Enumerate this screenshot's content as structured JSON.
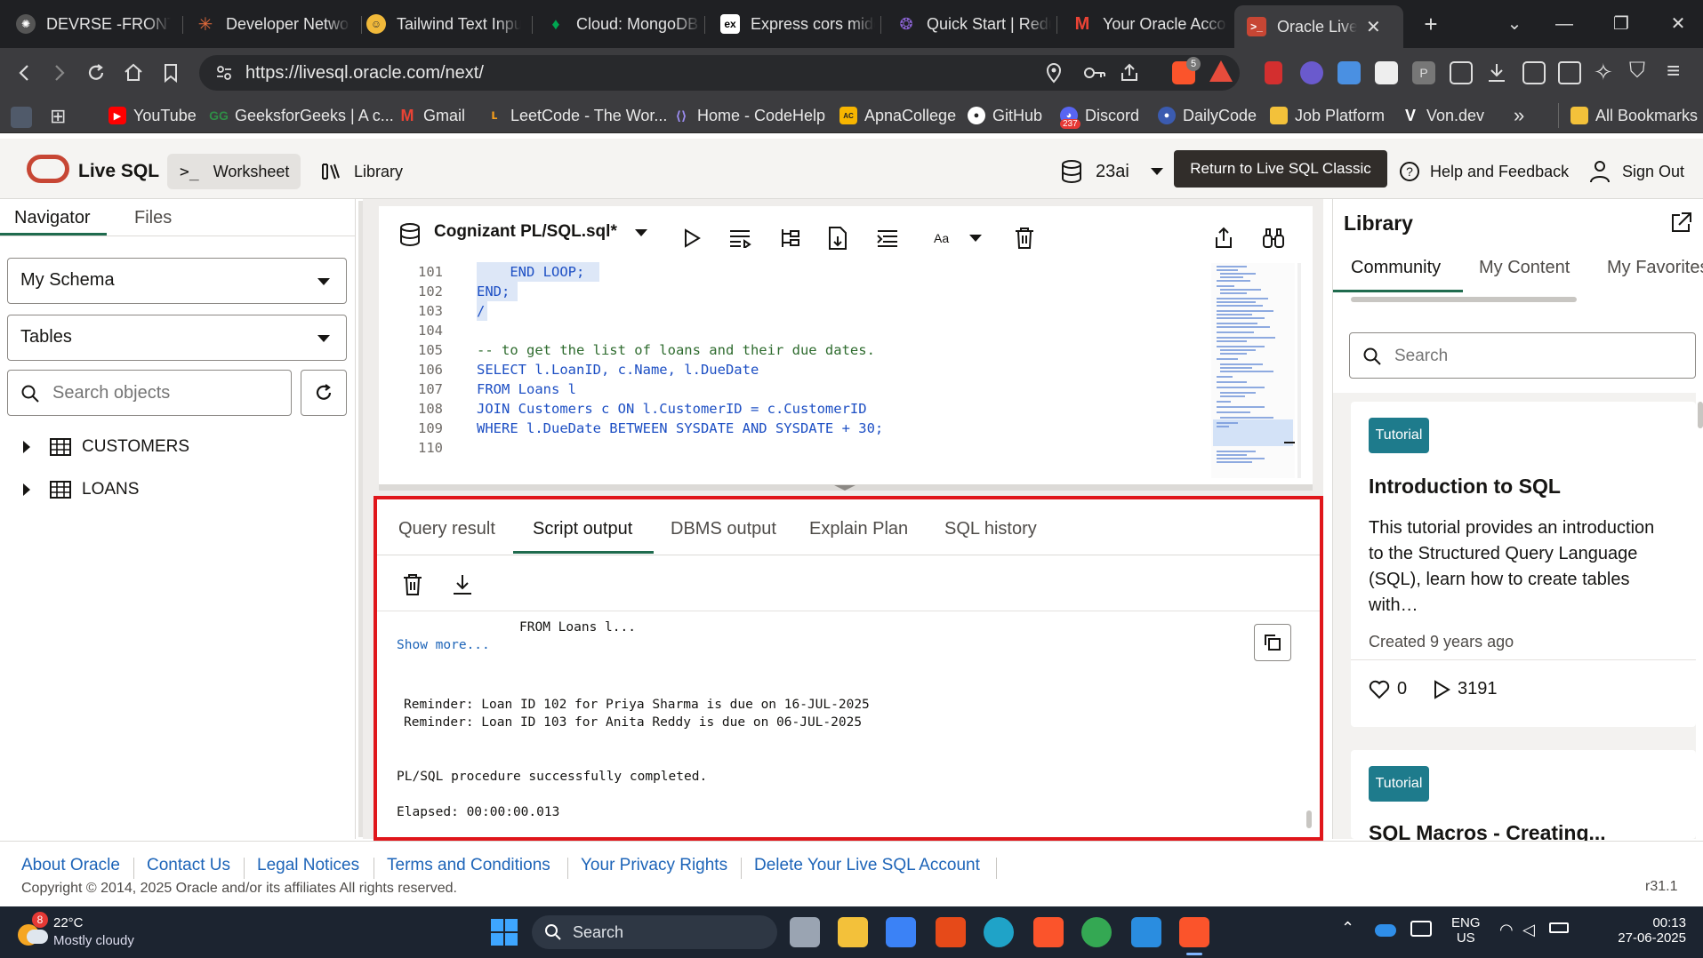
{
  "browser": {
    "tabs": [
      {
        "title": "DEVRSE -FRONTE",
        "color": "#6b6b6b"
      },
      {
        "title": "Developer Netwo",
        "color": "#e06a3b"
      },
      {
        "title": "Tailwind Text Inpu",
        "color": "#f1b93a"
      },
      {
        "title": "Cloud: MongoDB",
        "color": "#00a651"
      },
      {
        "title": "Express cors midd",
        "color": "#ffffff"
      },
      {
        "title": "Quick Start | Redu",
        "color": "#764abc"
      },
      {
        "title": "Your Oracle Accou",
        "color": "#ea4335"
      },
      {
        "title": "Oracle Live S",
        "color": "#c74634"
      }
    ],
    "express_fav": "ex",
    "url": "https://livesql.oracle.com/next/",
    "bookmarks": [
      {
        "label": "YouTube",
        "color": "#ff0000"
      },
      {
        "label": "GeeksforGeeks | A c...",
        "color": "#2f8d46"
      },
      {
        "label": "Gmail",
        "color": "#ea4335"
      },
      {
        "label": "LeetCode - The Wor...",
        "color": "#f89f1b"
      },
      {
        "label": "Home - CodeHelp",
        "color": "#6e5bd8"
      },
      {
        "label": "ApnaCollege",
        "color": "#f7b500"
      },
      {
        "label": "GitHub",
        "color": "#ffffff"
      },
      {
        "label": "Discord",
        "color": "#5865f2"
      },
      {
        "label": "DailyCode",
        "color": "#3b82f6"
      },
      {
        "label": "Job Platform",
        "color": "#f3c13a"
      },
      {
        "label": "Von.dev",
        "color": "#ffffff"
      }
    ],
    "more_bookmarks": "»",
    "all_bookmarks": "All Bookmarks",
    "discord_badge": "237",
    "brave_badge": "5"
  },
  "app": {
    "brand": "Live SQL",
    "worksheet": "Worksheet",
    "library": "Library",
    "db_version": "23ai",
    "classic_button": "Return to Live SQL Classic",
    "help": "Help and Feedback",
    "signout": "Sign Out"
  },
  "navigator": {
    "tabs": [
      "Navigator",
      "Files"
    ],
    "schema": "My Schema",
    "object_type": "Tables",
    "search_placeholder": "Search objects",
    "tables": [
      "CUSTOMERS",
      "LOANS"
    ]
  },
  "editor": {
    "file_name": "Cognizant PL/SQL.sql*",
    "font_label": "Aa",
    "lines": [
      {
        "n": "101",
        "text": "    END LOOP;"
      },
      {
        "n": "102",
        "text": "END;"
      },
      {
        "n": "103",
        "text": "/"
      },
      {
        "n": "104",
        "text": ""
      },
      {
        "n": "105",
        "text": "-- to get the list of loans and their due dates."
      },
      {
        "n": "106",
        "text": "SELECT l.LoanID, c.Name, l.DueDate"
      },
      {
        "n": "107",
        "text": "FROM Loans l"
      },
      {
        "n": "108",
        "text": "JOIN Customers c ON l.CustomerID = c.CustomerID"
      },
      {
        "n": "109",
        "text": "WHERE l.DueDate BETWEEN SYSDATE AND SYSDATE + 30;"
      },
      {
        "n": "110",
        "text": ""
      }
    ]
  },
  "results": {
    "tabs": [
      "Query result",
      "Script output",
      "DBMS output",
      "Explain Plan",
      "SQL history"
    ],
    "output": {
      "from_line": "FROM Loans l...",
      "show_more": "Show more...",
      "reminder1": "Reminder: Loan ID 102 for Priya Sharma is due on 16-JUL-2025",
      "reminder2": "Reminder: Loan ID 103 for Anita Reddy is due on 06-JUL-2025",
      "completed": "PL/SQL procedure successfully completed.",
      "elapsed": "Elapsed: 00:00:00.013"
    }
  },
  "library": {
    "title": "Library",
    "tabs": [
      "Community",
      "My Content",
      "My Favorites"
    ],
    "search_placeholder": "Search",
    "cards": [
      {
        "badge": "Tutorial",
        "title": "Introduction to SQL",
        "desc": "This tutorial provides an introduction to the Structured Query Language (SQL), learn how to create tables with…",
        "created": "Created 9 years ago",
        "likes": "0",
        "plays": "3191"
      },
      {
        "badge": "Tutorial",
        "title": "SQL Macros - Creating..."
      }
    ]
  },
  "footer": {
    "links": [
      "About Oracle",
      "Contact Us",
      "Legal Notices",
      "Terms and Conditions",
      "Your Privacy Rights",
      "Delete Your Live SQL Account"
    ],
    "copyright": "Copyright © 2014, 2025 Oracle and/or its affiliates All rights reserved.",
    "version": "r31.1"
  },
  "taskbar": {
    "weather_badge": "8",
    "temp": "22°C",
    "condition": "Mostly cloudy",
    "search": "Search",
    "lang1": "ENG",
    "lang2": "US",
    "time": "00:13",
    "date": "27-06-2025"
  },
  "colors": {
    "oracle_red": "#c74634",
    "highlight_border": "#e0161b",
    "accent_green": "#1f6b4e",
    "badge_teal": "#1e7b8c"
  }
}
